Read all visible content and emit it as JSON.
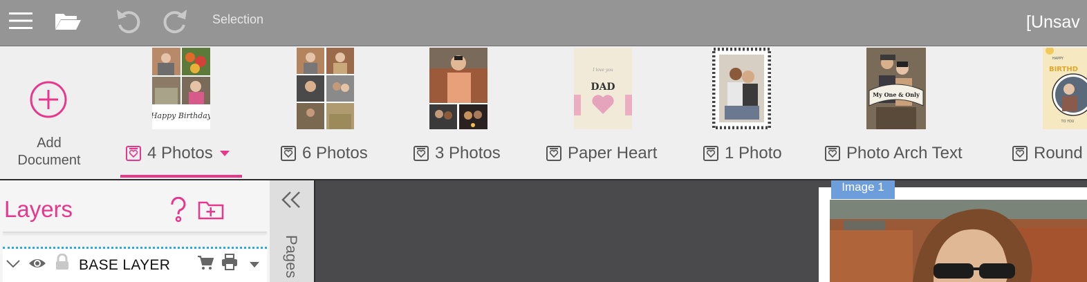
{
  "toolbar": {
    "menu_icon": "hamburger-menu-icon",
    "open_icon": "folder-open-icon",
    "undo_icon": "undo-icon",
    "redo_icon": "redo-icon",
    "mode_label": "Selection",
    "document_title": "[Unsav"
  },
  "documents": {
    "add_label_line1": "Add",
    "add_label_line2": "Document",
    "templates": [
      {
        "label": "4 Photos",
        "active": true
      },
      {
        "label": "6 Photos"
      },
      {
        "label": "3 Photos"
      },
      {
        "label": "Paper Heart"
      },
      {
        "label": "1 Photo"
      },
      {
        "label": "Photo Arch Text"
      },
      {
        "label": "Round"
      }
    ],
    "thumb_text": {
      "birthday": "Happy Birthday",
      "dad": "DAD",
      "dad_small": "I love you",
      "arch": "My One & Only",
      "round_top": "HAPPY",
      "round_mid": "BIRTHD",
      "round_bottom": "TO YOU"
    },
    "accent_color": "#e8378b"
  },
  "layers": {
    "title": "Layers",
    "help_icon": "help-icon",
    "add_folder_icon": "add-folder-icon",
    "rows": [
      {
        "name": "BASE LAYER"
      }
    ]
  },
  "pages": {
    "collapse_icon": "double-chevron-left-icon",
    "label": "Pages"
  },
  "canvas": {
    "image_tag": "Image 1"
  }
}
